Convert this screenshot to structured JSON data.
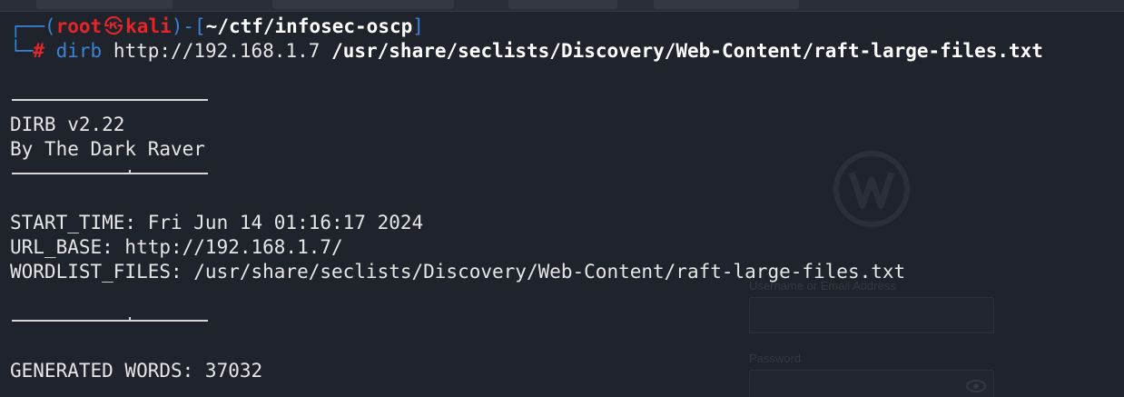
{
  "terminal": {
    "prompt": {
      "open_bracket": "┌──(",
      "user": "root",
      "skull_glyph": "㉿",
      "host": "kali",
      "mid": ")-[",
      "cwd": "~/ctf/infosec-oscp",
      "close_bracket": "]",
      "line2_prefix": "└─",
      "hash": "#"
    },
    "command": {
      "program": "dirb",
      "url": "http://192.168.1.7",
      "wordlist": "/usr/share/seclists/Discovery/Web-Content/raft-large-files.txt"
    },
    "output": {
      "version": "DIRB v2.22",
      "author": "By The Dark Raver",
      "start_time": "START_TIME: Fri Jun 14 01:16:17 2024",
      "url_base": "URL_BASE: http://192.168.1.7/",
      "wordlist_files": "WORDLIST_FILES: /usr/share/seclists/Discovery/Web-Content/raft-large-files.txt",
      "generated_words": "GENERATED WORDS: 37032"
    }
  },
  "background_page": {
    "username_label": "Username or Email Address",
    "password_label": "Password"
  },
  "colors": {
    "background": "#1f232b",
    "prompt_blue": "#3b83d6",
    "prompt_red": "#e2262a",
    "text": "#e6e6e6"
  }
}
